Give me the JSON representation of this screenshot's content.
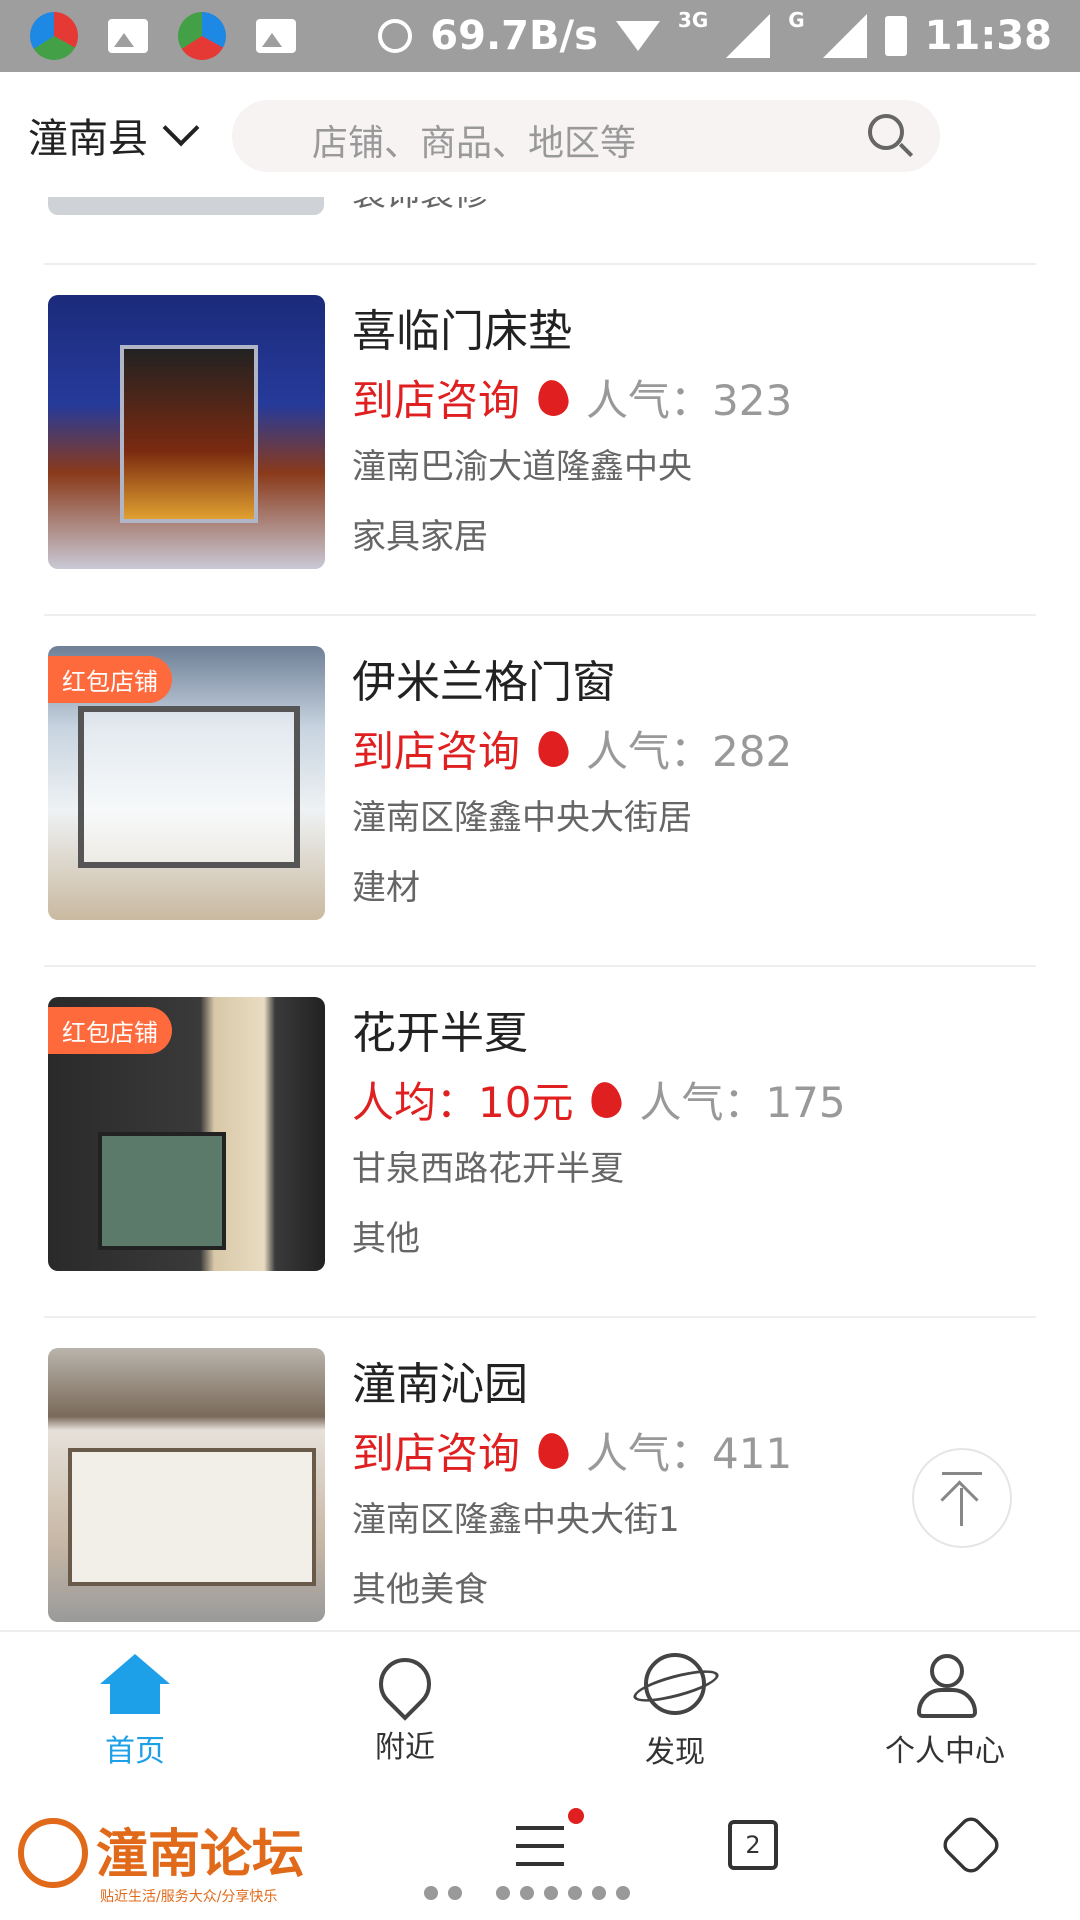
{
  "status_bar": {
    "speed": "69.7B/s",
    "net_tag_1": "3G",
    "net_tag_2": "G",
    "time": "11:38"
  },
  "header": {
    "location": "潼南县",
    "search_placeholder": "店铺、商品、地区等"
  },
  "partial_item": {
    "category_fragment": "装饰装修"
  },
  "items": [
    {
      "title": "喜临门床垫",
      "price": "到店咨询",
      "popularity": "人气：323",
      "address": "潼南巴渝大道隆鑫中央",
      "category": "家具家居",
      "badge": ""
    },
    {
      "title": "伊米兰格门窗",
      "price": "到店咨询",
      "popularity": "人气：282",
      "address": "潼南区隆鑫中央大街居",
      "category": "建材",
      "badge": "红包店铺"
    },
    {
      "title": "花开半夏",
      "price": "人均：10元",
      "popularity": "人气：175",
      "address": "甘泉西路花开半夏",
      "category": "其他",
      "badge": "红包店铺"
    },
    {
      "title": "潼南沁园",
      "price": "到店咨询",
      "popularity": "人气：411",
      "address": "潼南区隆鑫中央大街1",
      "category": "其他美食",
      "badge": ""
    }
  ],
  "tabs": [
    {
      "label": "首页",
      "icon": "home-icon"
    },
    {
      "label": "附近",
      "icon": "location-pin-icon"
    },
    {
      "label": "发现",
      "icon": "planet-icon"
    },
    {
      "label": "个人中心",
      "icon": "person-icon"
    }
  ],
  "system_nav": {
    "logo_text": "潼南论坛",
    "logo_subtitle": "贴近生活/服务大众/分享快乐",
    "task_count": "2"
  },
  "colors": {
    "accent_blue": "#1ea0e8",
    "price_red": "#e02020",
    "badge_orange": "#ff6a3d",
    "logo_orange": "#e06a1a"
  }
}
